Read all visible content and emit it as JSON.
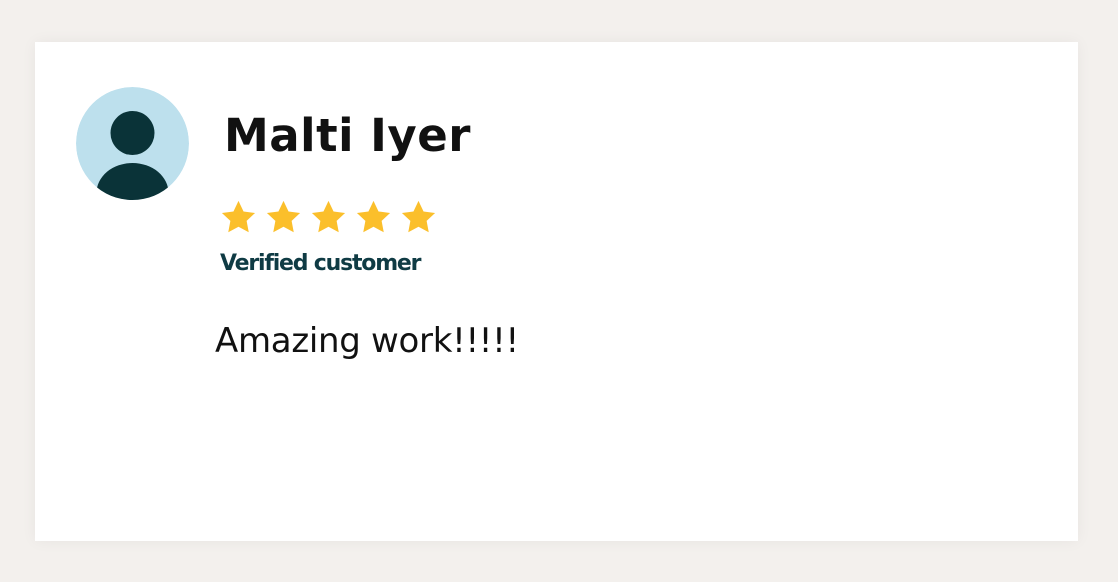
{
  "review": {
    "reviewer_name": "Malti Iyer",
    "rating": 5,
    "rating_max": 5,
    "badge": "Verified customer",
    "text": "Amazing work!!!!!"
  },
  "icons": {
    "avatar": "user-avatar-icon",
    "star": "star-icon"
  },
  "colors": {
    "page_background": "#f3f0ed",
    "card_background": "#ffffff",
    "avatar_background": "#bde0ed",
    "avatar_figure": "#0a3338",
    "star": "#fbbf2b",
    "badge_text": "#0f3b44"
  }
}
